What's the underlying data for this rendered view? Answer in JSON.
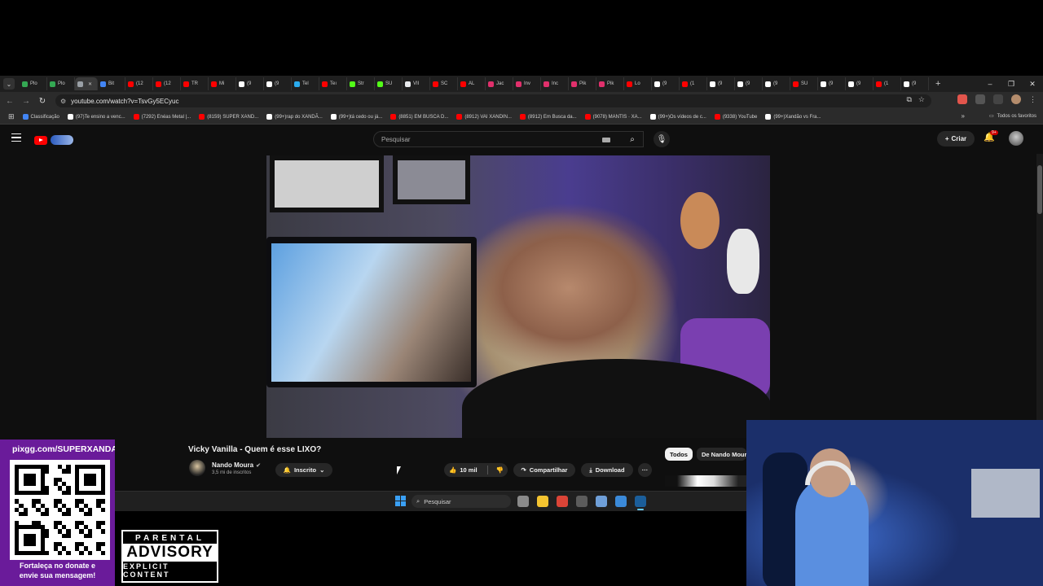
{
  "browser": {
    "tabs": [
      {
        "label": "Plo",
        "color": "#34a853"
      },
      {
        "label": "Plo",
        "color": "#34a853"
      },
      {
        "label": "",
        "color": "#9aa0a6",
        "active": true
      },
      {
        "label": "Bit",
        "color": "#4285f4"
      },
      {
        "label": "(12",
        "color": "#ff0000"
      },
      {
        "label": "(12",
        "color": "#ff0000"
      },
      {
        "label": "TR",
        "color": "#ff0000"
      },
      {
        "label": "Mi",
        "color": "#ff0000"
      },
      {
        "label": "(9",
        "color": "#ffffff"
      },
      {
        "label": "(9",
        "color": "#ffffff"
      },
      {
        "label": "Tel",
        "color": "#2aabee"
      },
      {
        "label": "Teı",
        "color": "#ff0000"
      },
      {
        "label": "Str",
        "color": "#53fc18"
      },
      {
        "label": "SU",
        "color": "#53fc18"
      },
      {
        "label": "VII",
        "color": "#e8eaed"
      },
      {
        "label": "SC",
        "color": "#ff0000"
      },
      {
        "label": "AL",
        "color": "#ff0000"
      },
      {
        "label": "Jac",
        "color": "#e1306c"
      },
      {
        "label": "Inv",
        "color": "#e1306c"
      },
      {
        "label": "Inc",
        "color": "#e1306c"
      },
      {
        "label": "Pik",
        "color": "#e1306c"
      },
      {
        "label": "Pik",
        "color": "#e1306c"
      },
      {
        "label": "Lo",
        "color": "#ff0000"
      },
      {
        "label": "(9",
        "color": "#ffffff"
      },
      {
        "label": "(1",
        "color": "#ff0000"
      },
      {
        "label": "(9",
        "color": "#ffffff"
      },
      {
        "label": "(9",
        "color": "#ffffff"
      },
      {
        "label": "(9",
        "color": "#ffffff"
      },
      {
        "label": "SU",
        "color": "#ff0000"
      },
      {
        "label": "(9",
        "color": "#ffffff"
      },
      {
        "label": "(9",
        "color": "#ffffff"
      },
      {
        "label": "(1",
        "color": "#ff0000"
      },
      {
        "label": "(9",
        "color": "#ffffff"
      }
    ],
    "new_tab": "+",
    "window_controls": {
      "minimize": "–",
      "restore": "❐",
      "close": "✕"
    },
    "url": "youtube.com/watch?v=TsvGy5ECyuc",
    "bookmarks": [
      {
        "label": "Classificação",
        "color": "#4285f4"
      },
      {
        "label": "(97)Te ensino a venc...",
        "color": "#ffffff"
      },
      {
        "label": "(7292) Enéas Metal |...",
        "color": "#ff0000"
      },
      {
        "label": "(8159) SUPER XAND...",
        "color": "#ff0000"
      },
      {
        "label": "(99+)rap do XANDÃ...",
        "color": "#ffffff"
      },
      {
        "label": "(99+)tá cedo ou já...",
        "color": "#ffffff"
      },
      {
        "label": "(8851) EM BUSCA D...",
        "color": "#ff0000"
      },
      {
        "label": "(8912) VAI XANDIN...",
        "color": "#ff0000"
      },
      {
        "label": "(8912) Em Busca da...",
        "color": "#ff0000"
      },
      {
        "label": "(9078) MANTIS · XA...",
        "color": "#ff0000"
      },
      {
        "label": "(99+)Os vídeos de c...",
        "color": "#ffffff"
      },
      {
        "label": "(9338) YouTube",
        "color": "#ff0000"
      },
      {
        "label": "(99+)Xandão vs Fra...",
        "color": "#ffffff"
      }
    ],
    "all_bookmarks": "Todos os favoritos",
    "more_bookmarks": "»"
  },
  "youtube": {
    "search_placeholder": "Pesquisar",
    "create_label": "Criar",
    "notifications_badge": "9+",
    "video_title": "Vicky Vanilla - Quem é esse LIXO?",
    "channel_name": "Nando Moura",
    "verified_mark": "✔",
    "subscribers": "3,5 mi de inscritos",
    "subscribed_label": "Inscrito",
    "likes": "10 mil",
    "share_label": "Compartilhar",
    "download_label": "Download",
    "more_label": "···",
    "chip_all": "Todos",
    "chip_from": "De Nando Moura"
  },
  "taskbar": {
    "search_placeholder": "Pesquisar",
    "apps": [
      {
        "name": "task-view-icon",
        "color": "#8a8a8a"
      },
      {
        "name": "file-explorer-icon",
        "color": "#f4c430"
      },
      {
        "name": "chrome-icon",
        "color": "#db4437"
      },
      {
        "name": "obs-icon",
        "color": "#5c5c5c"
      },
      {
        "name": "settings-icon",
        "color": "#6f9fd8"
      },
      {
        "name": "app-icon",
        "color": "#3b8ad9"
      },
      {
        "name": "steam-icon",
        "color": "#1b5e9a",
        "active": true
      }
    ]
  },
  "overlay": {
    "pix_url": "pixgg.com/SUPERXANDAO",
    "qr_caption_1": "Fortaleça no donate e",
    "qr_caption_2": "envie sua mensagem!",
    "advisory_top": "PARENTAL",
    "advisory_mid": "ADVISORY",
    "advisory_bot": "EXPLICIT CONTENT"
  },
  "colors": {
    "youtube_red": "#ff0000",
    "overlay_purple": "#6a1b9a",
    "bg_dark": "#0f0f0f"
  }
}
